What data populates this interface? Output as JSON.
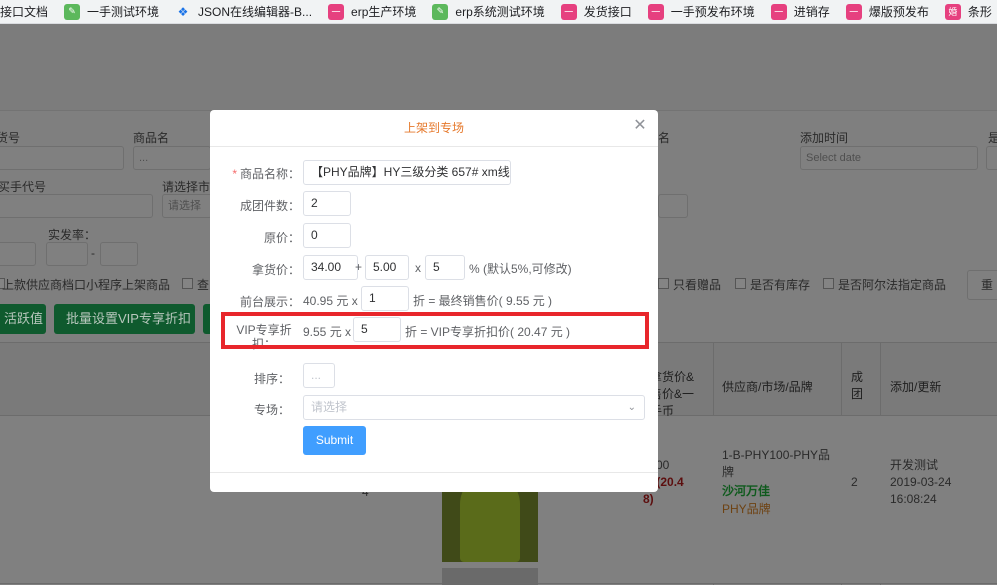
{
  "bookmarks": [
    {
      "label": "接口文档",
      "icon": "none"
    },
    {
      "label": "一手测试环境",
      "icon": "leaf-icon"
    },
    {
      "label": "JSON在线编辑器-B...",
      "icon": "json-icon"
    },
    {
      "label": "erp生产环境",
      "icon": "pink-app-icon"
    },
    {
      "label": "erp系统测试环境",
      "icon": "leaf-icon"
    },
    {
      "label": "发货接口",
      "icon": "pink-app-icon"
    },
    {
      "label": "一手预发布环境",
      "icon": "pink-app-icon"
    },
    {
      "label": "进销存",
      "icon": "pink-app-icon"
    },
    {
      "label": "爆版预发布",
      "icon": "pink-app-icon"
    },
    {
      "label": "条形",
      "icon": "pink-app-icon"
    }
  ],
  "background": {
    "filters": {
      "item_no_label": "货号",
      "product_name_label": "商品名",
      "name_label": "名",
      "add_time_label": "添加时间",
      "add_time_placeholder": "Select date",
      "shi_label": "是",
      "buyer_code_label": "买手代号",
      "market_select_label": "请选择市",
      "select_placeholder": "请选择",
      "actual_rate_label": "实发率：",
      "dash": "-",
      "ellipsis": "...",
      "checkbox_supplier_mini": "上款供应商档口小程序上架商品",
      "checkbox_cha": "查",
      "checkbox_gift": "只看赠品",
      "checkbox_stock": "是否有库存",
      "checkbox_alpha": "是否阿尔法指定商品",
      "reset_button": "重"
    },
    "actions": {
      "activate_button": "活跃值",
      "batch_vip_button": "批量设置VIP专享折扣"
    },
    "table": {
      "price_header": "拿货价&售价&一手币",
      "supplier_header": "供应商/市场/品牌",
      "group_header": "成团",
      "update_header": "添加/更新",
      "row": {
        "col_a": "4",
        "price_line1": "00",
        "price_line2": "95(20.4",
        "price_line3": "8)",
        "supplier_code": "1-B-PHY100-PHY品牌",
        "market": "沙河万佳",
        "brand": "PHY品牌",
        "group_count": "2",
        "updater": "开发测试",
        "updated_at": "2019-03-24 16:08:24"
      }
    }
  },
  "modal": {
    "title": "上架到专场",
    "fields": {
      "product_name": {
        "label": "商品名称：",
        "value": "【PHY品牌】HY三级分类 657# xm线"
      },
      "group_qty": {
        "label": "成团件数：",
        "value": "2"
      },
      "original_price": {
        "label": "原价：",
        "value": "0"
      },
      "purchase_price": {
        "label": "拿货价：",
        "base": "34.00",
        "plus": "+",
        "add": "5.00",
        "times": "x",
        "percent": "5",
        "note": "% (默认5%,可修改)"
      },
      "front_display": {
        "label": "前台展示：",
        "price_prefix": "40.95 元 x",
        "discount": "1",
        "result": "折 = 最终销售价( 9.55 元 )"
      },
      "vip_discount": {
        "label": "VIP专享折扣：",
        "price_prefix": "9.55 元 x",
        "discount": "5",
        "result": "折 = VIP专享折扣价( 20.47 元 )"
      },
      "sort": {
        "label": "排序：",
        "placeholder": "..."
      },
      "venue": {
        "label": "专场：",
        "placeholder": "请选择"
      }
    },
    "submit_label": "Submit"
  },
  "colors": {
    "accent_title": "#e6792c",
    "primary_button": "#409eff",
    "highlight_border": "#e8262b",
    "required_mark": "#f56c6c"
  }
}
